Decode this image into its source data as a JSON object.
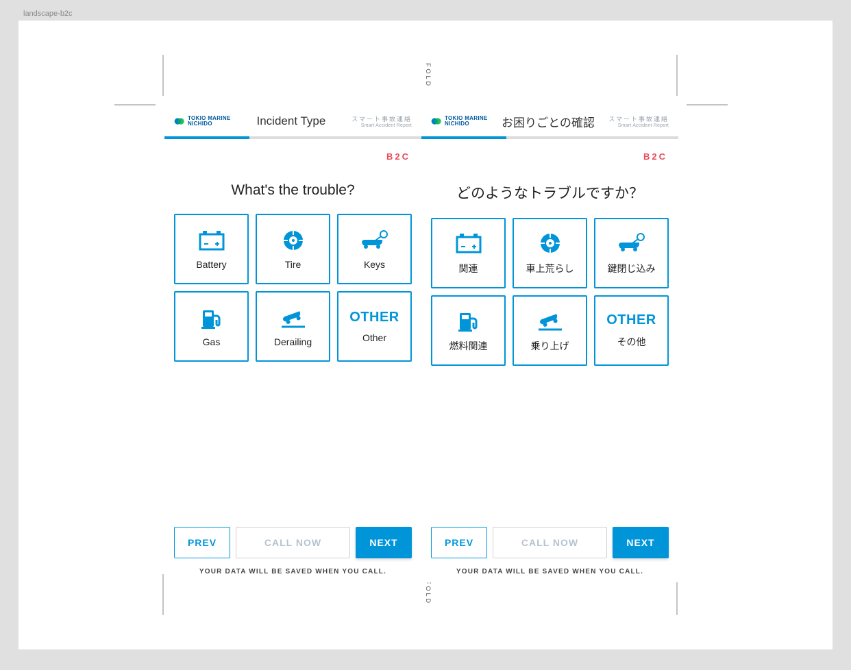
{
  "artboard_label": "landscape-b2c",
  "fold": "FOLD",
  "version_tag": "B2C",
  "brand": {
    "line1": "TOKIO MARINE",
    "line2": "NICHIDO"
  },
  "smart": {
    "jp": "スマート事故連絡",
    "en": "Smart Accident Report"
  },
  "panels": {
    "en": {
      "title": "Incident Type",
      "prompt": "What's the trouble?",
      "cards": [
        {
          "label": "Battery"
        },
        {
          "label": "Tire"
        },
        {
          "label": "Keys"
        },
        {
          "label": "Gas"
        },
        {
          "label": "Derailing"
        },
        {
          "label": "Other",
          "other_text": "OTHER"
        }
      ],
      "buttons": {
        "prev": "PREV",
        "call": "CALL NOW",
        "next": "NEXT"
      },
      "footnote": "YOUR DATA WILL BE SAVED WHEN YOU CALL."
    },
    "jp": {
      "title": "お困りごとの確認",
      "prompt": "どのようなトラブルですか？",
      "cards": [
        {
          "label": "関連"
        },
        {
          "label": "車上荒らし"
        },
        {
          "label": "鍵閉じ込み"
        },
        {
          "label": "燃料関連"
        },
        {
          "label": "乗り上げ"
        },
        {
          "label": "その他",
          "other_text": "OTHER"
        }
      ],
      "buttons": {
        "prev": "PREV",
        "call": "CALL NOW",
        "next": "NEXT"
      },
      "footnote": "YOUR DATA WILL BE SAVED WHEN YOU CALL."
    }
  },
  "progress_percent": 33
}
